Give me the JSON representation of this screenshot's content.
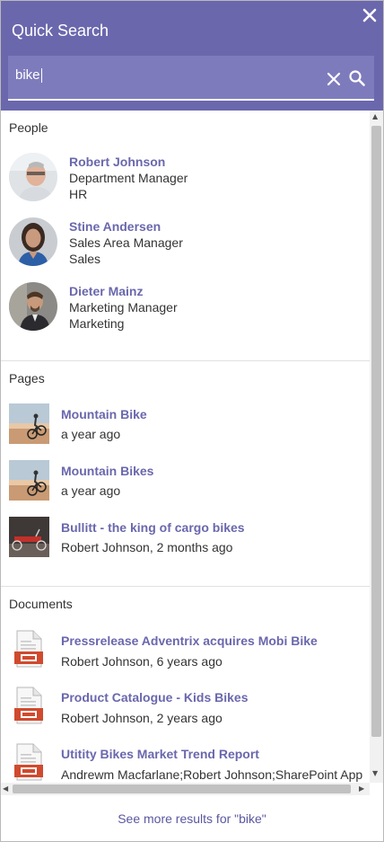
{
  "header": {
    "title": "Quick Search",
    "icons": {
      "close": "close-icon",
      "clear": "clear-icon",
      "search": "search-icon"
    }
  },
  "search": {
    "value": "bike"
  },
  "colors": {
    "accent": "#6a67ad",
    "header_bg": "#6a67ad",
    "link": "#6a67ad"
  },
  "sections": {
    "people": {
      "label": "People",
      "items": [
        {
          "name": "Robert Johnson",
          "title": "Department Manager",
          "department": "HR"
        },
        {
          "name": "Stine Andersen",
          "title": "Sales Area Manager",
          "department": "Sales"
        },
        {
          "name": "Dieter Mainz",
          "title": "Marketing Manager",
          "department": "Marketing"
        }
      ]
    },
    "pages": {
      "label": "Pages",
      "items": [
        {
          "title": "Mountain Bike",
          "meta": "a year ago"
        },
        {
          "title": "Mountain Bikes",
          "meta": "a year ago"
        },
        {
          "title": "Bullitt - the king of cargo bikes",
          "meta": "Robert Johnson, 2 months ago"
        }
      ]
    },
    "documents": {
      "label": "Documents",
      "items": [
        {
          "title": "Pressrelease Adventrix acquires Mobi Bike",
          "meta": "Robert Johnson, 6 years ago",
          "icon": "powerpoint-file-icon"
        },
        {
          "title": "Product Catalogue - Kids Bikes",
          "meta": "Robert Johnson, 2 years ago",
          "icon": "powerpoint-file-icon"
        },
        {
          "title": "Utitity Bikes Market Trend Report",
          "meta": "Andrewm Macfarlane;Robert Johnson;SharePoint App",
          "icon": "powerpoint-file-icon"
        }
      ]
    }
  },
  "footer": {
    "see_more": "See more results for \"bike\""
  }
}
